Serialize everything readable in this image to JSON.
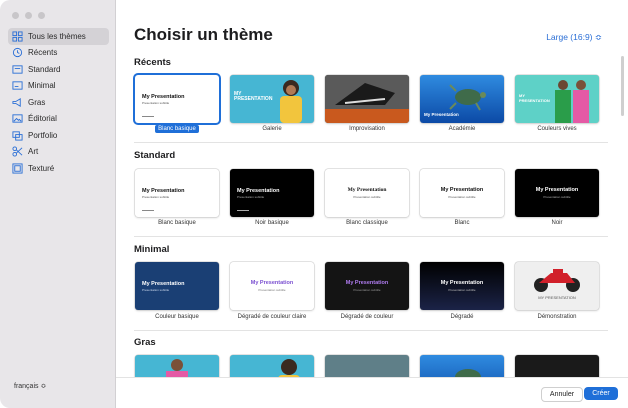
{
  "sidebar": {
    "items": [
      {
        "label": "Tous les thèmes",
        "icon": "grid-icon"
      },
      {
        "label": "Récents",
        "icon": "clock-icon"
      },
      {
        "label": "Standard",
        "icon": "slide-icon"
      },
      {
        "label": "Minimal",
        "icon": "minimal-icon"
      },
      {
        "label": "Gras",
        "icon": "megaphone-icon"
      },
      {
        "label": "Éditorial",
        "icon": "photo-icon"
      },
      {
        "label": "Portfolio",
        "icon": "portfolio-icon"
      },
      {
        "label": "Art",
        "icon": "scissors-icon"
      },
      {
        "label": "Texturé",
        "icon": "texture-icon"
      }
    ],
    "language": "français ≎"
  },
  "header": {
    "title": "Choisir un thème",
    "size": "Large (16:9) ≎"
  },
  "sections": [
    {
      "title": "Récents",
      "themes": [
        "Blanc basique",
        "Galerie",
        "Improvisation",
        "Académie",
        "Couleurs vives"
      ]
    },
    {
      "title": "Standard",
      "themes": [
        "Blanc basique",
        "Noir basique",
        "Blanc classique",
        "Blanc",
        "Noir"
      ]
    },
    {
      "title": "Minimal",
      "themes": [
        "Couleur basique",
        "Dégradé de couleur claire",
        "Dégradé de couleur",
        "Dégradé",
        "Démonstration"
      ]
    },
    {
      "title": "Gras",
      "themes": []
    }
  ],
  "thumb_text": {
    "mp": "My Presentation",
    "mp_caps": "MY PRESENTATION",
    "sub": "Presentation subtitle"
  },
  "buttons": {
    "cancel": "Annuler",
    "create": "Créer"
  },
  "colors": {
    "accent": "#1f6fd8"
  }
}
